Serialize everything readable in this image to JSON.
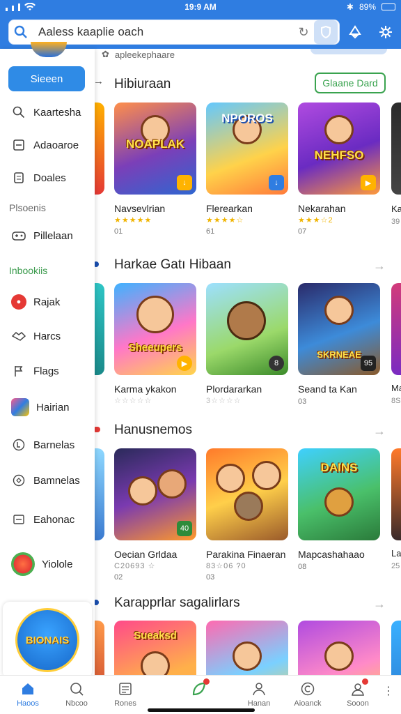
{
  "status_bar": {
    "time": "19:9 AM",
    "battery": "89%"
  },
  "search": {
    "placeholder": "Aaless kaaplie oach"
  },
  "icons": {
    "search": "search-icon",
    "refresh": "refresh-icon",
    "shield": "shield-icon",
    "notifications": "bell-icon",
    "settings": "gear-icon"
  },
  "sidebar": {
    "button_label": "Sieeen",
    "items_top": [
      {
        "label": "Kaartesha",
        "icon": "search-icon"
      },
      {
        "label": "Adaoaroe",
        "icon": "app-icon"
      },
      {
        "label": "Doales",
        "icon": "document-icon"
      }
    ],
    "section1": "Plsoenis",
    "section1_items": [
      {
        "label": "Pillelaan",
        "icon": "gamepad-icon"
      }
    ],
    "section2": "Inbookiis",
    "section2_items": [
      {
        "label": "Rajak",
        "icon": "chat-icon"
      },
      {
        "label": "Harcs",
        "icon": "handshake-icon"
      },
      {
        "label": "Flags",
        "icon": "flag-icon"
      },
      {
        "label": "Hairian",
        "icon": "game-app-icon"
      },
      {
        "label": "Barnelas",
        "icon": "bookmark-icon"
      },
      {
        "label": "Bamnelas",
        "icon": "chat-bubble-icon"
      },
      {
        "label": "Eahonac",
        "icon": "image-icon"
      },
      {
        "label": "Yiolole",
        "icon": "game-logo-icon"
      }
    ],
    "promo_text": "BIONAIS"
  },
  "main": {
    "sub_text": "apleekephaare",
    "sections": [
      {
        "title": "Hibiuraan",
        "action": "Glaane Dard",
        "cards": [
          {
            "word": "NOAPLAK",
            "name": "Navsevlrian",
            "stars": "★★★★★",
            "meta": "01"
          },
          {
            "word": "NPOROS",
            "name": "Flerearkan",
            "stars": "★★★★☆",
            "meta": "61"
          },
          {
            "word": "NEHFSO",
            "name": "Nekarahan",
            "stars": "★★★☆2",
            "meta": "07"
          }
        ],
        "peek": {
          "name": "Ka",
          "meta": "39"
        }
      },
      {
        "title": "Harkae Gatı Hibaan",
        "action": "",
        "cards": [
          {
            "word": "Sheeupers",
            "name": "Karma ykakon",
            "stars": "☆☆☆☆☆",
            "meta": ""
          },
          {
            "word": "",
            "name": "Plordararkan",
            "stars": "3☆☆☆☆",
            "meta": "03"
          },
          {
            "word": "SKRNEAE",
            "name": "Seand ta Kan",
            "stars": "",
            "meta": "03"
          }
        ],
        "peek": {
          "name": "Ma",
          "meta": "8S"
        }
      },
      {
        "title": "Hanusnemos",
        "action": "",
        "cards": [
          {
            "word": "",
            "name": "Oecian Grldaa",
            "stars": "C20693 ☆",
            "meta": "02"
          },
          {
            "word": "",
            "name": "Parakina Finaeran",
            "stars": "83☆06 ?0",
            "meta": "03"
          },
          {
            "word": "DAINS",
            "name": "Mapcashahaao",
            "stars": "",
            "meta": "08"
          }
        ],
        "peek": {
          "name": "La",
          "meta": "25"
        }
      },
      {
        "title": "Karapprlar sagalirlars",
        "action": "",
        "cards": [
          {
            "word": "Sueaksd",
            "name": "",
            "stars": "",
            "meta": ""
          },
          {
            "word": "",
            "name": "",
            "stars": "",
            "meta": ""
          },
          {
            "word": "",
            "name": "",
            "stars": "",
            "meta": ""
          }
        ],
        "peek": {
          "name": "",
          "meta": ""
        }
      }
    ]
  },
  "bottom_nav": [
    {
      "label": "Haoos",
      "icon": "home-icon",
      "active": true
    },
    {
      "label": "Nbcoo",
      "icon": "search-icon"
    },
    {
      "label": "Rones",
      "icon": "list-icon"
    },
    {
      "label": "",
      "icon": "leaf-icon"
    },
    {
      "label": "Hanan",
      "icon": "person-icon"
    },
    {
      "label": "Aioanck",
      "icon": "copyright-icon"
    },
    {
      "label": "Sooon",
      "icon": "user-icon"
    }
  ],
  "colors": {
    "primary": "#2f7de1",
    "accent_green": "#3aa34f",
    "star": "#f0b400"
  }
}
